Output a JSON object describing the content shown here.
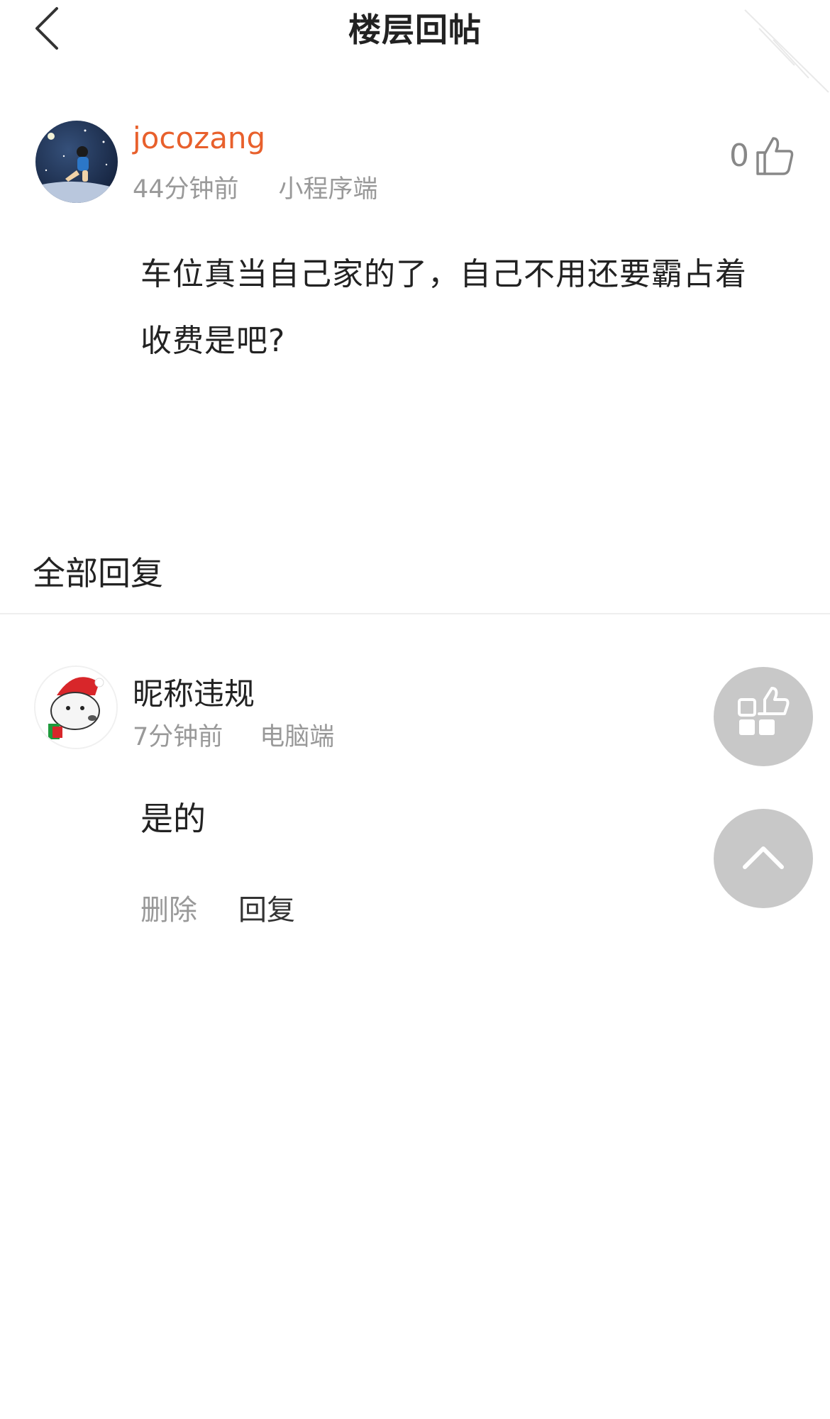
{
  "header": {
    "title": "楼层回帖"
  },
  "post": {
    "author": "jocozang",
    "time": "44分钟前",
    "source": "小程序端",
    "like_count": "0",
    "content": "车位真当自己家的了，自己不用还要霸占着收费是吧?"
  },
  "replies": {
    "title": "全部回复",
    "items": [
      {
        "author": "昵称违规",
        "time": "7分钟前",
        "source": "电脑端",
        "content": "是的",
        "delete_label": "删除",
        "reply_label": "回复"
      }
    ]
  },
  "colors": {
    "author_accent": "#e8602c",
    "meta_text": "#999999",
    "fab_bg": "#c8c8c8"
  },
  "icons": {
    "back": "chevron-left-icon",
    "like": "thumbs-up-icon",
    "apps": "apps-like-icon",
    "scroll_top": "chevron-up-icon"
  }
}
